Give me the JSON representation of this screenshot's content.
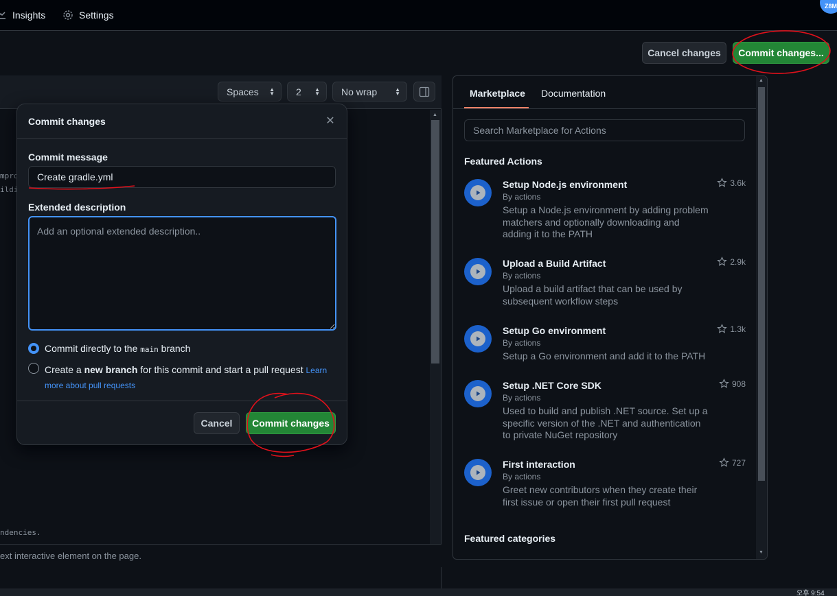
{
  "nav": {
    "insights_label": "Insights",
    "settings_label": "Settings",
    "avatar_text": "Z8M"
  },
  "header_actions": {
    "cancel_label": "Cancel changes",
    "commit_label": "Commit changes..."
  },
  "editor": {
    "indent_mode": "Spaces",
    "indent_size": "2",
    "wrap_mode": "No wrap",
    "code_fragments": [
      "mpro",
      "ildi",
      "ndencies."
    ],
    "status_text": "ext interactive element on the page."
  },
  "modal": {
    "title": "Commit changes",
    "commit_message_label": "Commit message",
    "commit_message_value": "Create gradle.yml",
    "extended_label": "Extended description",
    "extended_placeholder": "Add an optional extended description..",
    "option_direct_prefix": "Commit directly to the ",
    "option_direct_branch": "main",
    "option_direct_suffix": " branch",
    "option_new_prefix": "Create a ",
    "option_new_bold": "new branch",
    "option_new_suffix": " for this commit and start a pull request ",
    "learn_more_line1": "Learn",
    "learn_more_line2": "more about pull requests",
    "cancel_label": "Cancel",
    "commit_label": "Commit changes"
  },
  "marketplace": {
    "tabs": [
      "Marketplace",
      "Documentation"
    ],
    "search_placeholder": "Search Marketplace for Actions",
    "featured_actions_heading": "Featured Actions",
    "actions": [
      {
        "name": "Setup Node.js environment",
        "by": "By actions",
        "description": "Setup a Node.js environment by adding problem matchers and optionally downloading and adding it to the PATH",
        "stars": "3.6k"
      },
      {
        "name": "Upload a Build Artifact",
        "by": "By actions",
        "description": "Upload a build artifact that can be used by subsequent workflow steps",
        "stars": "2.9k"
      },
      {
        "name": "Setup Go environment",
        "by": "By actions",
        "description": "Setup a Go environment and add it to the PATH",
        "stars": "1.3k"
      },
      {
        "name": "Setup .NET Core SDK",
        "by": "By actions",
        "description": "Used to build and publish .NET source. Set up a specific version of the .NET and authentication to private NuGet repository",
        "stars": "908"
      },
      {
        "name": "First interaction",
        "by": "By actions",
        "description": "Greet new contributors when they create their first issue or open their first pull request",
        "stars": "727"
      }
    ],
    "featured_categories_heading": "Featured categories"
  },
  "taskbar": {
    "clock_fragment": "오후 9:54"
  },
  "colors": {
    "accent": "#4493f8",
    "primary_button": "#238636",
    "annotation": "#e0111b"
  }
}
